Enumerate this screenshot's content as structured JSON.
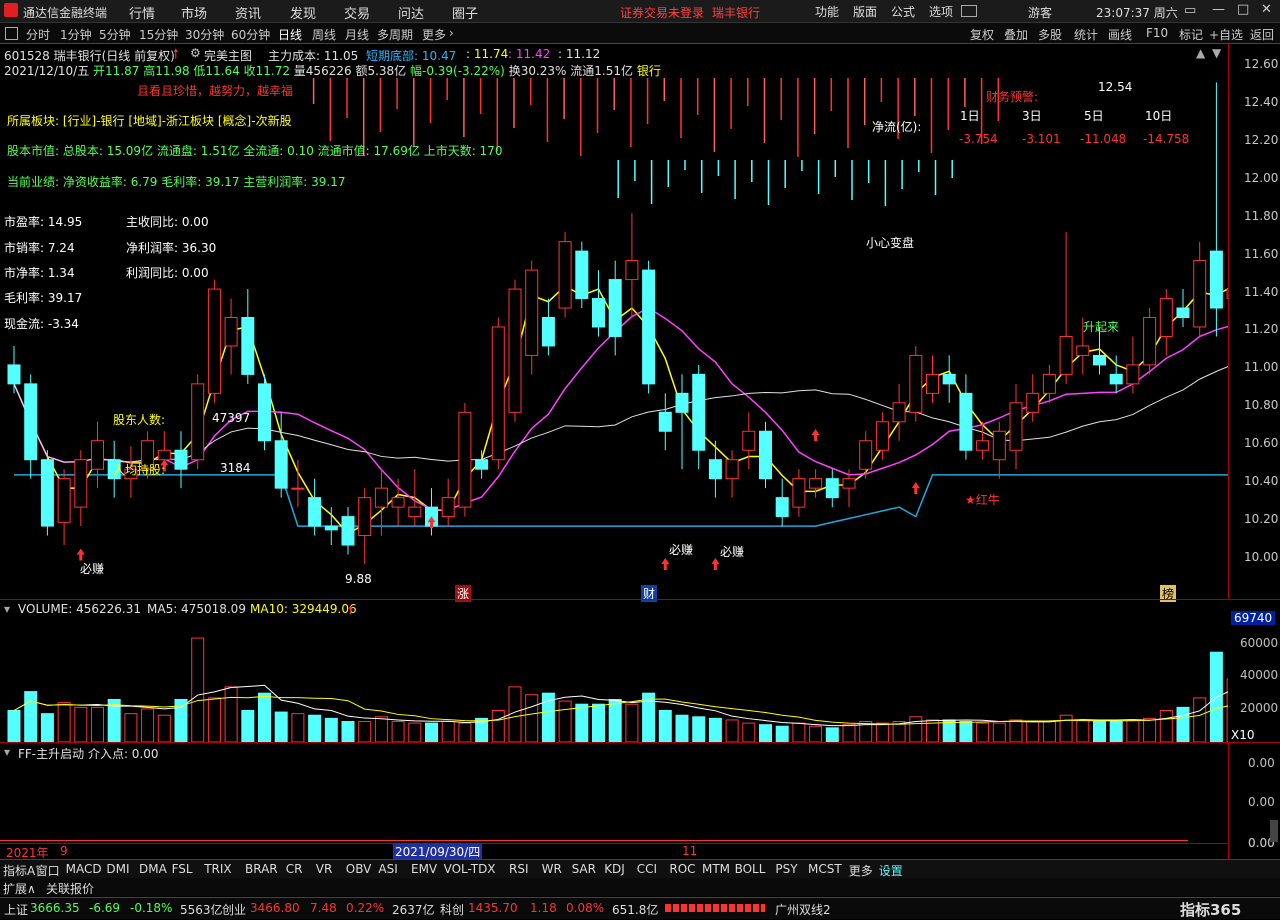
{
  "app": {
    "name": "通达信金融终端",
    "menus": [
      "行情",
      "市场",
      "资讯",
      "发现",
      "交易",
      "问达",
      "圈子"
    ],
    "notice": "证券交易未登录",
    "stock_title": "瑞丰银行",
    "right_menus": [
      "功能",
      "版面",
      "公式",
      "选项"
    ],
    "user": "游客",
    "clock": "23:07:37 周六"
  },
  "periods": [
    "分时",
    "1分钟",
    "5分钟",
    "15分钟",
    "30分钟",
    "60分钟",
    "日线",
    "周线",
    "月线",
    "多周期",
    "更多"
  ],
  "active_period": "日线",
  "tools": [
    "复权",
    "叠加",
    "多股",
    "统计",
    "画线",
    "F10",
    "标记",
    "+自选",
    "返回"
  ],
  "header": {
    "code_name": "601528 瑞丰银行(日线 前复权)",
    "main_chart": "完美主图",
    "cost_label": "主力成本: 11.05",
    "short_label": "短期底部: 10.47",
    "v1": ": 11.74",
    "v2": ": 11.42",
    "v3": ": 11.12"
  },
  "ohlc": {
    "date": "2021/12/10/五",
    "open": "开11.87",
    "high": "高11.98",
    "low": "低11.64",
    "close": "收11.72",
    "volume": "量456226",
    "amount": "额5.38亿",
    "change": "幅-0.39(-3.22%)",
    "turnover": "换30.23%",
    "float": "流通1.51亿",
    "industry": "银行"
  },
  "slogan": "且看且珍惜，越努力，越幸福",
  "info": {
    "sector": "所属板块: [行业]-银行 [地域]-浙江板块 [概念]-次新股",
    "capital": "股本市值: 总股本: 15.09亿 流通盘: 1.51亿 全流通: 0.10 流通市值: 17.69亿 上市天数: 170",
    "perf": "当前业绩: 净资收益率: 6.79 毛利率: 39.17 主营利润率: 39.17"
  },
  "metrics_left": [
    "市盈率: 14.95",
    "市销率: 7.24",
    "市净率: 1.34",
    "毛利率: 39.17",
    "现金流: -3.34"
  ],
  "metrics_right": [
    "主收同比: 0.00",
    "净利润率: 36.30",
    "利润同比: 0.00"
  ],
  "holders": {
    "label": "股东人数:",
    "value": "47397",
    "label2": "人均持股:",
    "value2": "3184"
  },
  "flow": {
    "title": "财务预警:",
    "label": "净流(亿):",
    "periods": [
      "1日",
      "3日",
      "5日",
      "10日"
    ],
    "values": [
      "-3.754",
      "-3.101",
      "-11.048",
      "-14.758"
    ]
  },
  "annotations": {
    "caution": "小心变盘",
    "bull": "★红牛",
    "buy": "必赚",
    "rise": "升起来",
    "peak": "12.54",
    "trough": "9.88",
    "mark_zhang": "涨",
    "mark_cai": "财",
    "mark_bang": "榜"
  },
  "price_axis": [
    "12.60",
    "12.40",
    "12.20",
    "12.00",
    "11.80",
    "11.60",
    "11.40",
    "11.20",
    "11.00",
    "10.80",
    "10.60",
    "10.40",
    "10.20",
    "10.00"
  ],
  "volume_header": {
    "label": "VOLUME: 456226.31",
    "ma5": "MA5: 475018.09",
    "ma10": "MA10: 329449.06"
  },
  "volume_axis": [
    "69740",
    "60000",
    "40000",
    "20000"
  ],
  "volume_unit": "X10",
  "ff_header": "FF-主升启动  介入点: 0.00",
  "ff_axis": [
    "0.00",
    "0.00",
    "0.00",
    "0.00"
  ],
  "time_axis": {
    "year": "2021年",
    "m9": "9",
    "cursor": "2021/09/30/四",
    "m11": "11"
  },
  "indicator_tabs": [
    "指标A",
    "窗口",
    "MACD",
    "DMI",
    "DMA",
    "FSL",
    "TRIX",
    "BRAR",
    "CR",
    "VR",
    "OBV",
    "ASI",
    "EMV",
    "VOL-TDX",
    "RSI",
    "WR",
    "SAR",
    "KDJ",
    "CCI",
    "ROC",
    "MTM",
    "BOLL",
    "PSY",
    "MCST",
    "更多",
    "设置"
  ],
  "sub_tabs": [
    "扩展∧",
    "关联报价"
  ],
  "status": {
    "sh": {
      "name": "上证",
      "val": "3666.35",
      "chg": "-6.69",
      "pct": "-0.18%",
      "amt": "5563亿"
    },
    "cy": {
      "name": "创业",
      "val": "3466.80",
      "chg": "7.48",
      "pct": "0.22%",
      "amt": "2637亿"
    },
    "kc": {
      "name": "科创",
      "val": "1435.70",
      "chg": "1.18",
      "pct": "0.08%",
      "amt": "651.8亿"
    },
    "server": "广州双线2",
    "brand": "指标365"
  },
  "colors": {
    "up": "#ff3232",
    "down": "#54ffff",
    "ma1": "#ffff00",
    "ma2": "#ff40ff",
    "ma3": "#e0e0e0",
    "support": "#1fa8e0"
  },
  "chart_data": {
    "type": "candlestick",
    "candles": [
      [
        11.05,
        11.15,
        10.9,
        10.95
      ],
      [
        10.95,
        11.0,
        10.45,
        10.55
      ],
      [
        10.55,
        10.6,
        10.15,
        10.2
      ],
      [
        10.22,
        10.5,
        10.1,
        10.45
      ],
      [
        10.3,
        10.6,
        10.2,
        10.55
      ],
      [
        10.5,
        10.75,
        10.4,
        10.65
      ],
      [
        10.55,
        10.65,
        10.35,
        10.45
      ],
      [
        10.45,
        10.62,
        10.35,
        10.5
      ],
      [
        10.5,
        10.7,
        10.45,
        10.65
      ],
      [
        10.55,
        10.7,
        10.5,
        10.6
      ],
      [
        10.6,
        10.7,
        10.4,
        10.5
      ],
      [
        10.55,
        11.0,
        10.5,
        10.95
      ],
      [
        10.9,
        11.5,
        10.85,
        11.45
      ],
      [
        11.15,
        11.4,
        11.0,
        11.3
      ],
      [
        11.3,
        11.45,
        10.95,
        11.0
      ],
      [
        10.95,
        11.0,
        10.6,
        10.65
      ],
      [
        10.65,
        10.8,
        10.35,
        10.4
      ],
      [
        10.4,
        10.55,
        10.3,
        10.4
      ],
      [
        10.35,
        10.45,
        10.15,
        10.2
      ],
      [
        10.2,
        10.3,
        10.1,
        10.18
      ],
      [
        10.25,
        10.3,
        10.05,
        10.1
      ],
      [
        10.15,
        10.4,
        10.0,
        10.35
      ],
      [
        10.3,
        10.5,
        10.15,
        10.4
      ],
      [
        10.3,
        10.45,
        10.2,
        10.35
      ],
      [
        10.25,
        10.5,
        10.2,
        10.3
      ],
      [
        10.3,
        10.4,
        10.15,
        10.2
      ],
      [
        10.25,
        10.45,
        10.2,
        10.35
      ],
      [
        10.3,
        10.85,
        10.25,
        10.8
      ],
      [
        10.55,
        10.6,
        10.45,
        10.5
      ],
      [
        10.55,
        11.3,
        10.5,
        11.25
      ],
      [
        10.8,
        11.5,
        10.75,
        11.45
      ],
      [
        11.1,
        11.6,
        11.0,
        11.55
      ],
      [
        11.3,
        11.4,
        11.1,
        11.15
      ],
      [
        11.35,
        11.75,
        11.3,
        11.7
      ],
      [
        11.65,
        11.7,
        11.35,
        11.4
      ],
      [
        11.4,
        11.55,
        11.2,
        11.25
      ],
      [
        11.5,
        11.6,
        11.1,
        11.2
      ],
      [
        11.5,
        11.85,
        11.3,
        11.6
      ],
      [
        11.55,
        11.6,
        10.9,
        10.95
      ],
      [
        10.8,
        10.9,
        10.6,
        10.7
      ],
      [
        10.9,
        11.0,
        10.5,
        10.8
      ],
      [
        11.0,
        11.05,
        10.5,
        10.6
      ],
      [
        10.55,
        10.65,
        10.35,
        10.45
      ],
      [
        10.45,
        10.6,
        10.35,
        10.55
      ],
      [
        10.6,
        10.8,
        10.5,
        10.7
      ],
      [
        10.7,
        10.75,
        10.4,
        10.45
      ],
      [
        10.35,
        10.45,
        10.2,
        10.25
      ],
      [
        10.3,
        10.5,
        10.25,
        10.45
      ],
      [
        10.4,
        10.5,
        10.35,
        10.45
      ],
      [
        10.45,
        10.5,
        10.3,
        10.35
      ],
      [
        10.4,
        10.5,
        10.3,
        10.45
      ],
      [
        10.5,
        10.7,
        10.45,
        10.65
      ],
      [
        10.6,
        10.8,
        10.55,
        10.75
      ],
      [
        10.75,
        10.95,
        10.65,
        10.85
      ],
      [
        10.8,
        11.15,
        10.75,
        11.1
      ],
      [
        10.9,
        11.1,
        10.85,
        11.0
      ],
      [
        11.0,
        11.1,
        10.85,
        10.95
      ],
      [
        10.9,
        11.0,
        10.55,
        10.6
      ],
      [
        10.6,
        10.75,
        10.55,
        10.65
      ],
      [
        10.55,
        10.75,
        10.45,
        10.7
      ],
      [
        10.6,
        10.95,
        10.5,
        10.85
      ],
      [
        10.8,
        11.0,
        10.75,
        10.9
      ],
      [
        10.9,
        11.05,
        10.85,
        11.0
      ],
      [
        11.0,
        11.75,
        10.95,
        11.2
      ],
      [
        11.1,
        11.3,
        11.0,
        11.15
      ],
      [
        11.1,
        11.25,
        11.0,
        11.05
      ],
      [
        11.0,
        11.1,
        10.9,
        10.95
      ],
      [
        10.95,
        11.2,
        10.9,
        11.05
      ],
      [
        11.05,
        11.35,
        11.0,
        11.3
      ],
      [
        11.2,
        11.45,
        11.1,
        11.4
      ],
      [
        11.35,
        11.45,
        11.25,
        11.3
      ],
      [
        11.25,
        11.7,
        11.2,
        11.6
      ],
      [
        11.65,
        12.54,
        11.2,
        11.35
      ],
      [
        11.4,
        11.5,
        11.15,
        11.45
      ],
      [
        11.25,
        12.4,
        11.2,
        12.1
      ],
      [
        11.87,
        11.98,
        11.64,
        11.72
      ]
    ],
    "ylim": [
      9.88,
      12.54
    ]
  }
}
